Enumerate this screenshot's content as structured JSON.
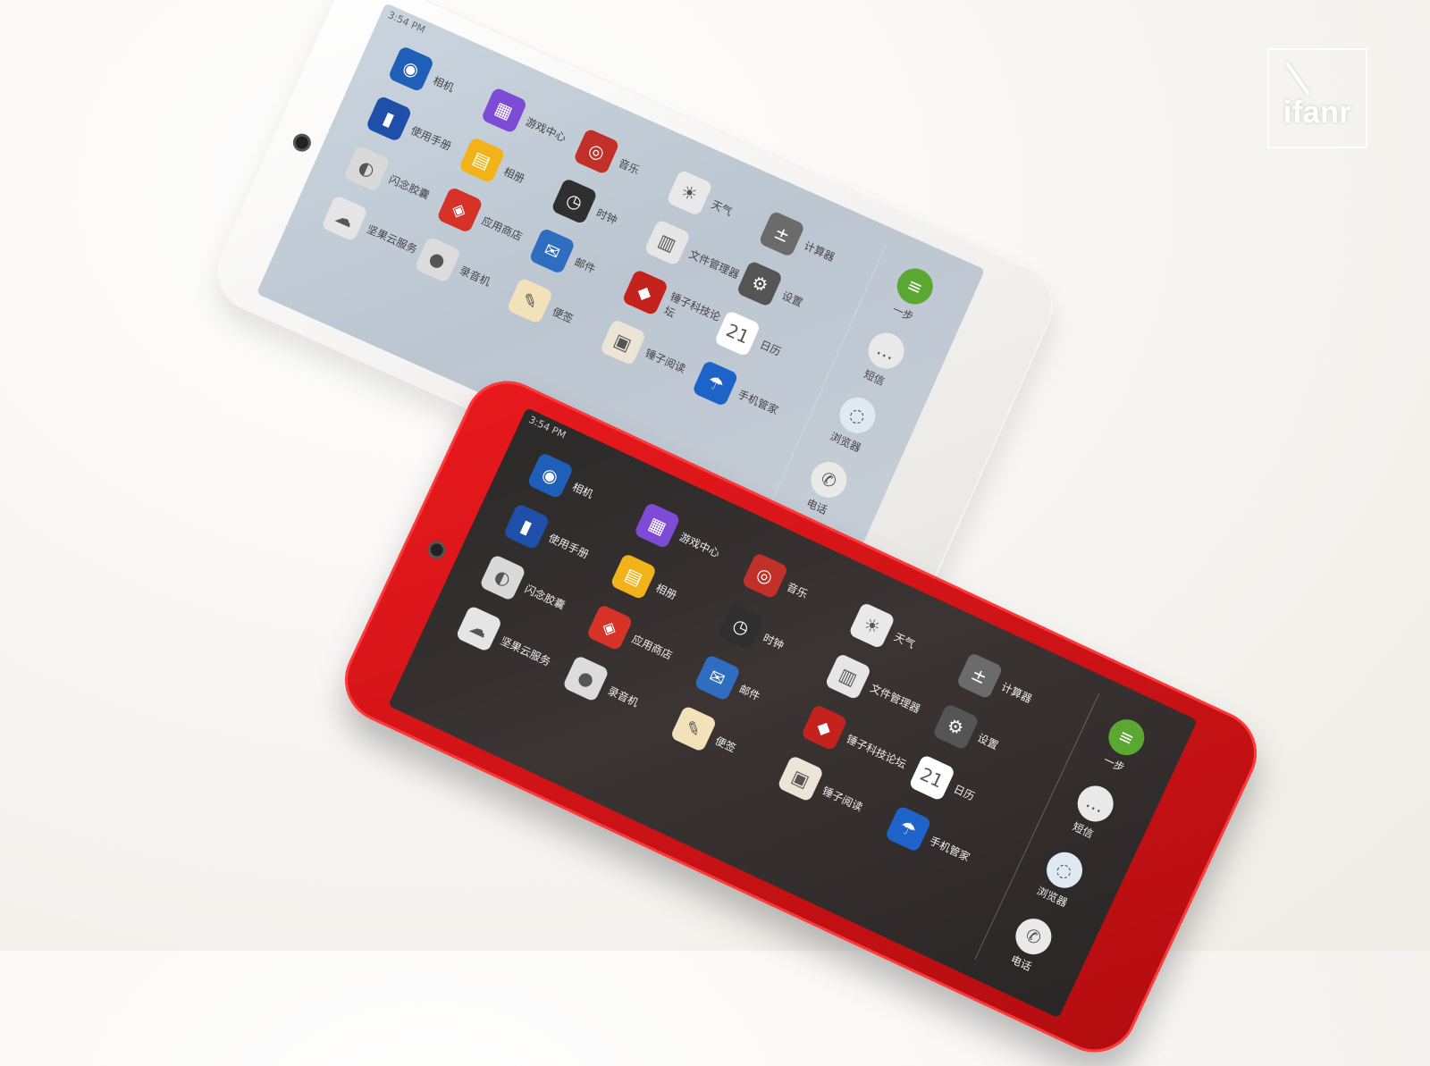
{
  "watermark": {
    "text": "ifanr"
  },
  "phones": {
    "red": {
      "status_time": "3:54 PM",
      "apps": [
        {
          "label": "相机",
          "icon": "camera-icon",
          "color": "#1f5fb8",
          "glyph": "◉"
        },
        {
          "label": "游戏中心",
          "icon": "game-center-icon",
          "color": "#7d4bd6",
          "glyph": "▦"
        },
        {
          "label": "音乐",
          "icon": "music-icon",
          "color": "#c2302a",
          "glyph": "◎"
        },
        {
          "label": "天气",
          "icon": "weather-icon",
          "color": "#e9e9e9",
          "glyph": "☀"
        },
        {
          "label": "计算器",
          "icon": "calculator-icon",
          "color": "#6b6b6b",
          "glyph": "±"
        },
        {
          "label": "使用手册",
          "icon": "manual-icon",
          "color": "#1f4fa8",
          "glyph": "▮"
        },
        {
          "label": "相册",
          "icon": "gallery-icon",
          "color": "#f2b21a",
          "glyph": "▤"
        },
        {
          "label": "时钟",
          "icon": "clock-icon",
          "color": "#2f2f2f",
          "glyph": "◷"
        },
        {
          "label": "文件管理器",
          "icon": "file-manager-icon",
          "color": "#e6e6e6",
          "glyph": "▥"
        },
        {
          "label": "设置",
          "icon": "settings-icon",
          "color": "#555555",
          "glyph": "⚙"
        },
        {
          "label": "闪念胶囊",
          "icon": "capsule-icon",
          "color": "#d9d9d9",
          "glyph": "◐"
        },
        {
          "label": "应用商店",
          "icon": "app-store-icon",
          "color": "#d63228",
          "glyph": "◈"
        },
        {
          "label": "邮件",
          "icon": "mail-icon",
          "color": "#2f6dc1",
          "glyph": "✉"
        },
        {
          "label": "锤子科技论坛",
          "icon": "forum-icon",
          "color": "#c4221d",
          "glyph": "◆"
        },
        {
          "label": "日历",
          "icon": "calendar-icon",
          "color": "#ffffff",
          "glyph": "21"
        },
        {
          "label": "坚果云服务",
          "icon": "cloud-icon",
          "color": "#e5e5e5",
          "glyph": "☁"
        },
        {
          "label": "录音机",
          "icon": "recorder-icon",
          "color": "#dcdcdc",
          "glyph": "●"
        },
        {
          "label": "便签",
          "icon": "notes-icon",
          "color": "#f3e2b9",
          "glyph": "✎"
        },
        {
          "label": "锤子阅读",
          "icon": "reader-icon",
          "color": "#ece4d6",
          "glyph": "▣"
        },
        {
          "label": "手机管家",
          "icon": "phone-manager-icon",
          "color": "#1e64c8",
          "glyph": "☂"
        }
      ],
      "dock": [
        {
          "label": "一步",
          "icon": "one-step-icon",
          "color": "#5aa832",
          "glyph": "≡"
        },
        {
          "label": "短信",
          "icon": "sms-icon",
          "color": "#e9e9e9",
          "glyph": "…"
        },
        {
          "label": "浏览器",
          "icon": "browser-icon",
          "color": "#dfe9f3",
          "glyph": "◌"
        },
        {
          "label": "电话",
          "icon": "phone-icon",
          "color": "#e9e9e9",
          "glyph": "✆"
        }
      ]
    },
    "white": {
      "status_time": "3:54 PM",
      "apps": [
        {
          "label": "相机",
          "icon": "camera-icon",
          "color": "#1f5fb8",
          "glyph": "◉"
        },
        {
          "label": "游戏中心",
          "icon": "game-center-icon",
          "color": "#7d4bd6",
          "glyph": "▦"
        },
        {
          "label": "音乐",
          "icon": "music-icon",
          "color": "#c2302a",
          "glyph": "◎"
        },
        {
          "label": "天气",
          "icon": "weather-icon",
          "color": "#e9e9e9",
          "glyph": "☀"
        },
        {
          "label": "计算器",
          "icon": "calculator-icon",
          "color": "#6b6b6b",
          "glyph": "±"
        },
        {
          "label": "使用手册",
          "icon": "manual-icon",
          "color": "#1f4fa8",
          "glyph": "▮"
        },
        {
          "label": "相册",
          "icon": "gallery-icon",
          "color": "#f2b21a",
          "glyph": "▤"
        },
        {
          "label": "时钟",
          "icon": "clock-icon",
          "color": "#2f2f2f",
          "glyph": "◷"
        },
        {
          "label": "文件管理器",
          "icon": "file-manager-icon",
          "color": "#e6e6e6",
          "glyph": "▥"
        },
        {
          "label": "设置",
          "icon": "settings-icon",
          "color": "#555555",
          "glyph": "⚙"
        },
        {
          "label": "闪念胶囊",
          "icon": "capsule-icon",
          "color": "#d9d9d9",
          "glyph": "◐"
        },
        {
          "label": "应用商店",
          "icon": "app-store-icon",
          "color": "#d63228",
          "glyph": "◈"
        },
        {
          "label": "邮件",
          "icon": "mail-icon",
          "color": "#2f6dc1",
          "glyph": "✉"
        },
        {
          "label": "锤子科技论坛",
          "icon": "forum-icon",
          "color": "#c4221d",
          "glyph": "◆"
        },
        {
          "label": "日历",
          "icon": "calendar-icon",
          "color": "#ffffff",
          "glyph": "21"
        },
        {
          "label": "坚果云服务",
          "icon": "cloud-icon",
          "color": "#e5e5e5",
          "glyph": "☁"
        },
        {
          "label": "录音机",
          "icon": "recorder-icon",
          "color": "#dcdcdc",
          "glyph": "●"
        },
        {
          "label": "便签",
          "icon": "notes-icon",
          "color": "#f3e2b9",
          "glyph": "✎"
        },
        {
          "label": "锤子阅读",
          "icon": "reader-icon",
          "color": "#ece4d6",
          "glyph": "▣"
        },
        {
          "label": "手机管家",
          "icon": "phone-manager-icon",
          "color": "#1e64c8",
          "glyph": "☂"
        }
      ],
      "dock": [
        {
          "label": "一步",
          "icon": "one-step-icon",
          "color": "#5aa832",
          "glyph": "≡"
        },
        {
          "label": "短信",
          "icon": "sms-icon",
          "color": "#e9e9e9",
          "glyph": "…"
        },
        {
          "label": "浏览器",
          "icon": "browser-icon",
          "color": "#dfe9f3",
          "glyph": "◌"
        },
        {
          "label": "电话",
          "icon": "phone-icon",
          "color": "#e9e9e9",
          "glyph": "✆"
        }
      ]
    }
  }
}
